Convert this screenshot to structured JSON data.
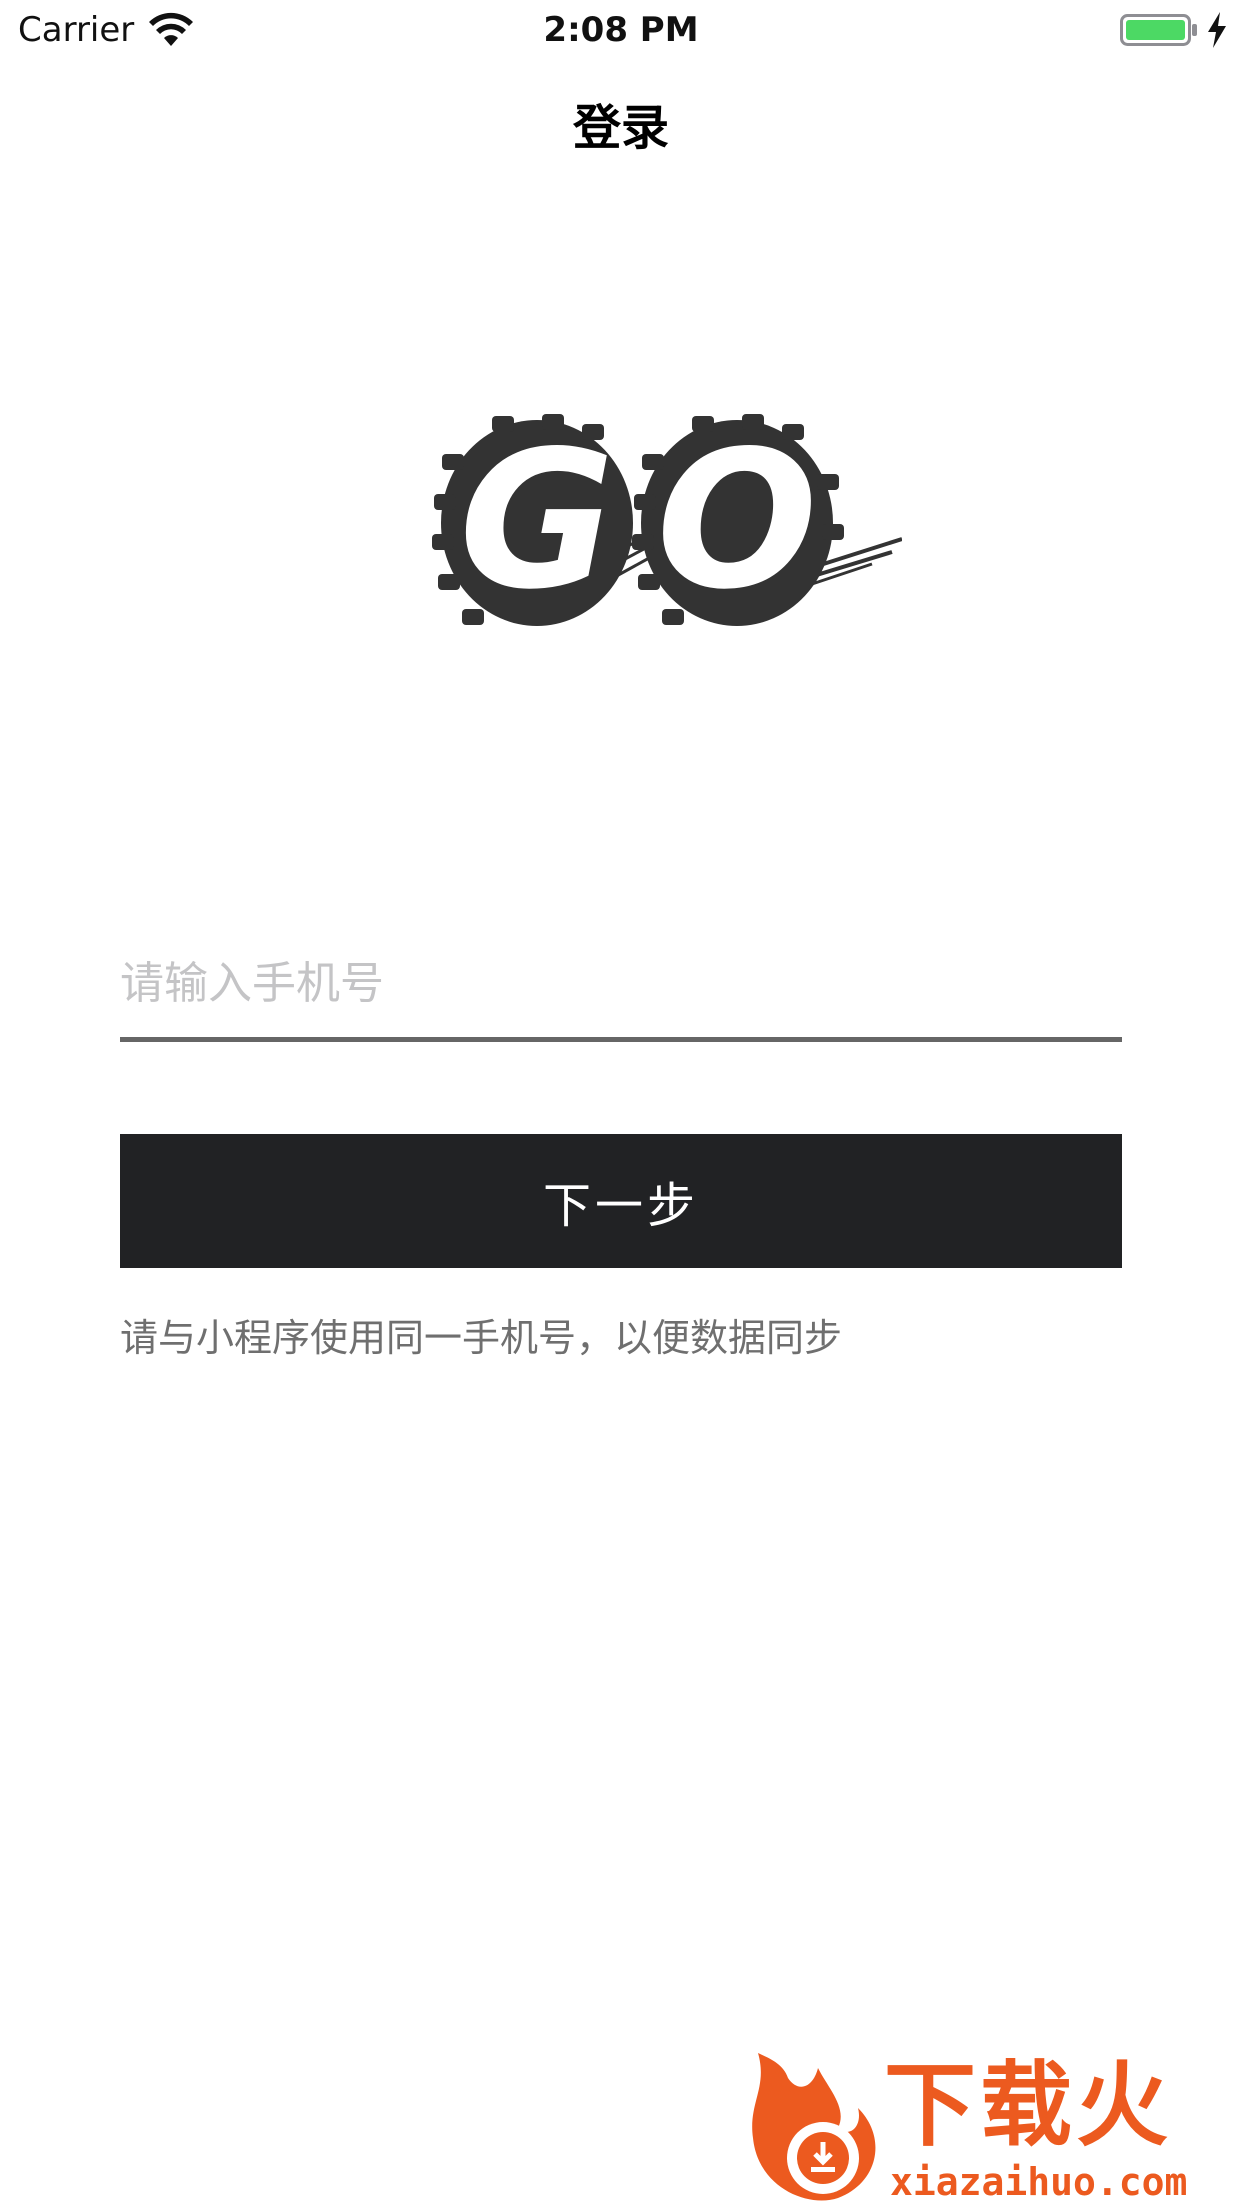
{
  "status_bar": {
    "carrier": "Carrier",
    "time": "2:08 PM",
    "icons": [
      "wifi-icon",
      "battery-icon",
      "charging-icon"
    ],
    "battery_color": "#4cd964"
  },
  "nav": {
    "title": "登录"
  },
  "logo": {
    "text": "GO",
    "color": "#333333"
  },
  "form": {
    "phone_placeholder": "请输入手机号",
    "phone_value": "",
    "next_button_label": "下一步",
    "hint": "请与小程序使用同一手机号，以便数据同步"
  },
  "colors": {
    "button_bg": "#212224",
    "input_underline": "#666666",
    "watermark": "#ec5a1f"
  },
  "watermark": {
    "title": "下载火",
    "url": "xiazaihuo.com"
  }
}
